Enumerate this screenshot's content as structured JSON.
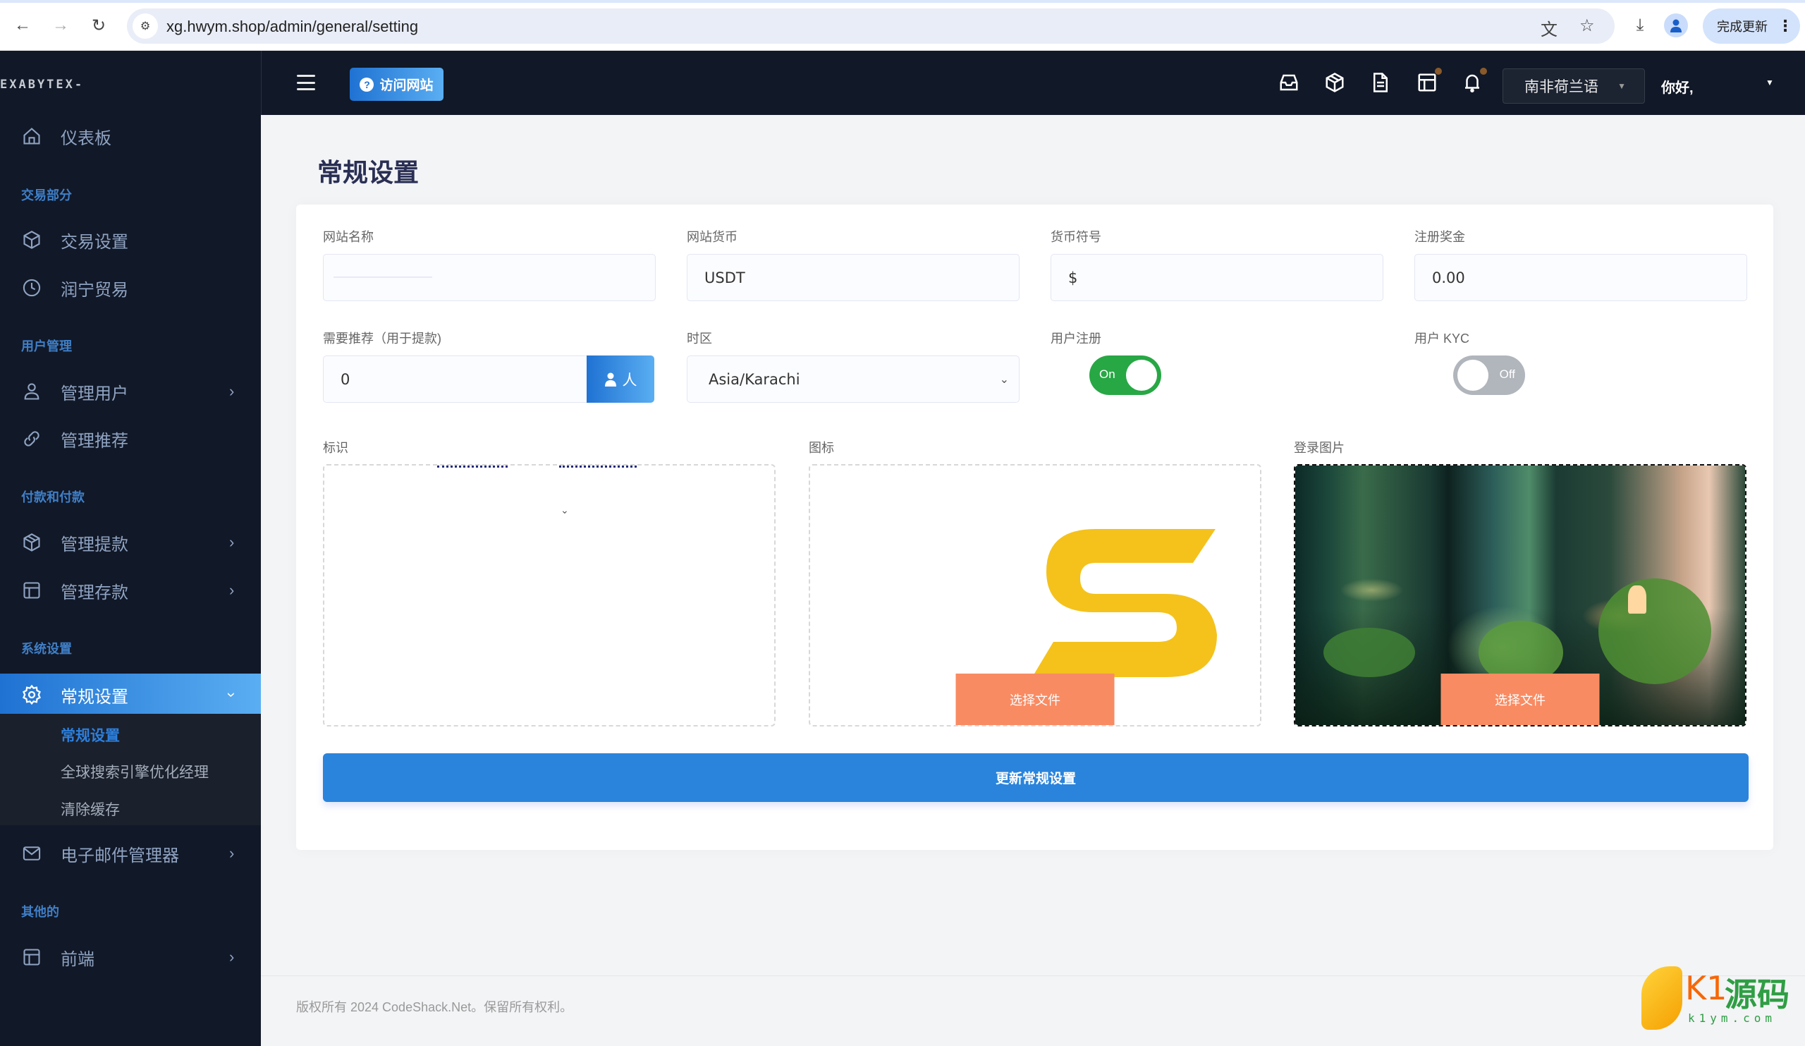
{
  "browser": {
    "url": "xg.hwym.shop/admin/general/setting",
    "update_label": "完成更新",
    "icons": [
      "back-icon",
      "forward-icon",
      "reload-icon",
      "site-info-icon",
      "translate-icon",
      "bookmark-star-icon",
      "download-icon",
      "profile-icon",
      "menu-dots-icon"
    ]
  },
  "sidebar": {
    "brand": "EXABYTEX-",
    "items": [
      {
        "type": "item",
        "label": "仪表板",
        "icon": "home-icon"
      },
      {
        "type": "section",
        "label": "交易部分"
      },
      {
        "type": "item",
        "label": "交易设置",
        "icon": "cube-icon"
      },
      {
        "type": "item",
        "label": "润宁贸易",
        "icon": "clock-icon"
      },
      {
        "type": "section",
        "label": "用户管理"
      },
      {
        "type": "item",
        "label": "管理用户",
        "icon": "user-icon",
        "has_children": true
      },
      {
        "type": "item",
        "label": "管理推荐",
        "icon": "link-icon"
      },
      {
        "type": "section",
        "label": "付款和付款"
      },
      {
        "type": "item",
        "label": "管理提款",
        "icon": "cube-icon",
        "has_children": true
      },
      {
        "type": "item",
        "label": "管理存款",
        "icon": "layout-icon",
        "has_children": true
      },
      {
        "type": "section",
        "label": "系统设置"
      },
      {
        "type": "item",
        "label": "常规设置",
        "icon": "gear-icon",
        "has_children": true,
        "active": true
      },
      {
        "type": "item",
        "label": "电子邮件管理器",
        "icon": "mail-icon",
        "has_children": true
      },
      {
        "type": "section",
        "label": "其他的"
      },
      {
        "type": "item",
        "label": "前端",
        "icon": "layout-icon",
        "has_children": true
      }
    ],
    "submenu": [
      {
        "label": "常规设置",
        "current": true
      },
      {
        "label": "全球搜索引擎优化经理",
        "current": false
      },
      {
        "label": "清除缓存",
        "current": false
      }
    ]
  },
  "topbar": {
    "visit_site_label": "访问网站",
    "language": "南非荷兰语",
    "greeting": "你好,",
    "icons": [
      "inbox-icon",
      "package-icon",
      "document-icon",
      "table-icon",
      "bell-icon"
    ]
  },
  "page": {
    "title": "常规设置",
    "fields": {
      "site_name": {
        "label": "网站名称",
        "value": ""
      },
      "site_currency": {
        "label": "网站货币",
        "value": "USDT"
      },
      "currency_symbol": {
        "label": "货币符号",
        "value": "$"
      },
      "signup_bonus": {
        "label": "注册奖金",
        "value": "0.00"
      },
      "referral_required": {
        "label": "需要推荐（用于提款)",
        "value": "0",
        "addon": "人"
      },
      "timezone": {
        "label": "时区",
        "value": "Asia/Karachi"
      },
      "user_registration": {
        "label": "用户注册",
        "state": "On",
        "enabled": true
      },
      "user_kyc": {
        "label": "用户 KYC",
        "state": "Off",
        "enabled": false
      }
    },
    "uploads": {
      "logo": {
        "label": "标识"
      },
      "favicon": {
        "label": "图标",
        "button": "选择文件"
      },
      "login_image": {
        "label": "登录图片",
        "button": "选择文件"
      }
    },
    "submit_label": "更新常规设置",
    "footer": "版权所有 2024 CodeShack.Net。保留所有权利。"
  },
  "watermark": {
    "brand": "K1",
    "brand_cn": "源码",
    "domain": "k1ym.com"
  },
  "colors": {
    "sidebar_bg": "#111827",
    "accent": "#2a84db",
    "toggle_on": "#28a745",
    "toggle_off": "#b1b5bc",
    "choose_file": "#f98b62",
    "favicon_yellow": "#f4c21b"
  }
}
